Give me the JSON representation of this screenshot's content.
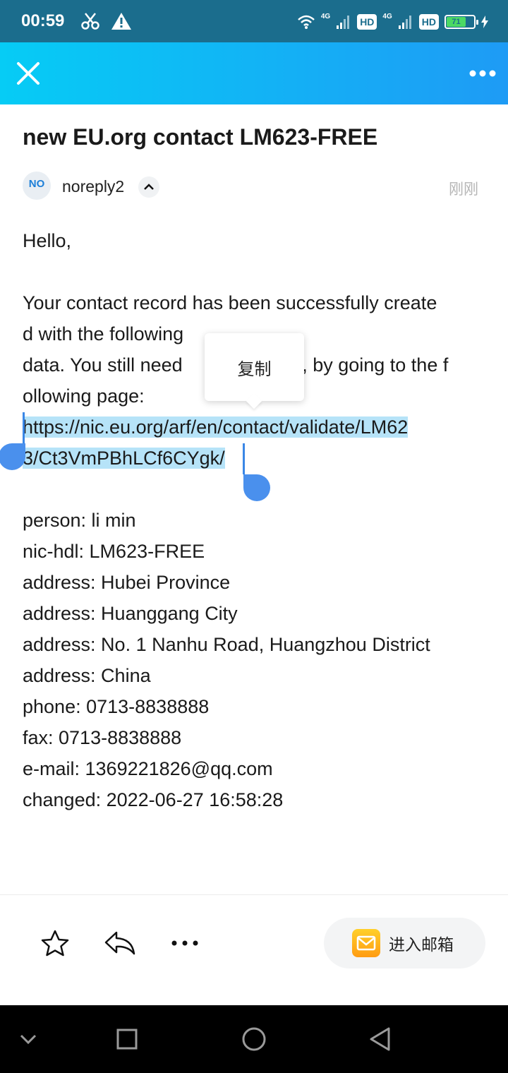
{
  "status_bar": {
    "time": "00:59",
    "network_1": "4G",
    "hd_1": "HD",
    "network_2": "4G",
    "hd_2": "HD",
    "battery": "71",
    "icons": [
      "scissors-icon",
      "warning-icon",
      "wifi-icon",
      "signal-icon",
      "battery-icon",
      "charging-icon"
    ]
  },
  "app_bar": {
    "icons": [
      "close-icon",
      "more-icon"
    ]
  },
  "email": {
    "subject": "new EU.org contact LM623-FREE",
    "sender_avatar": "NO",
    "sender_name": "noreply2",
    "time": "刚刚",
    "body_lines": [
      "Hello,",
      "",
      "Your contact record has been successfully create",
      "d with the following",
      "data. You still need",
      "ollowing page:"
    ],
    "body_line_3_tail": "it, by going to the f",
    "selected_link_lines": [
      "https://nic.eu.org/arf/en/contact/validate/LM62",
      "3/Ct3VmPBhLCf6CYgk/"
    ],
    "details": [
      "person: li min",
      "nic-hdl: LM623-FREE",
      "address: Hubei Province",
      "address: Huanggang City",
      "address: No. 1 Nanhu Road, Huangzhou District",
      "address: China",
      "phone: 0713-8838888",
      "fax: 0713-8838888",
      "e-mail: 1369221826@qq.com",
      "changed: 2022-06-27 16:58:28"
    ]
  },
  "popup": {
    "copy_label": "复制"
  },
  "bottom_bar": {
    "mailbox_label": "进入邮箱",
    "icons": [
      "star-icon",
      "reply-icon",
      "more-icon",
      "mail-icon"
    ]
  },
  "colors": {
    "status_bar": "#1b6d8d",
    "app_bar_start": "#06ccf5",
    "app_bar_end": "#1e9bf5",
    "selection": "#b6e3f8",
    "handle": "#4a90ed"
  }
}
